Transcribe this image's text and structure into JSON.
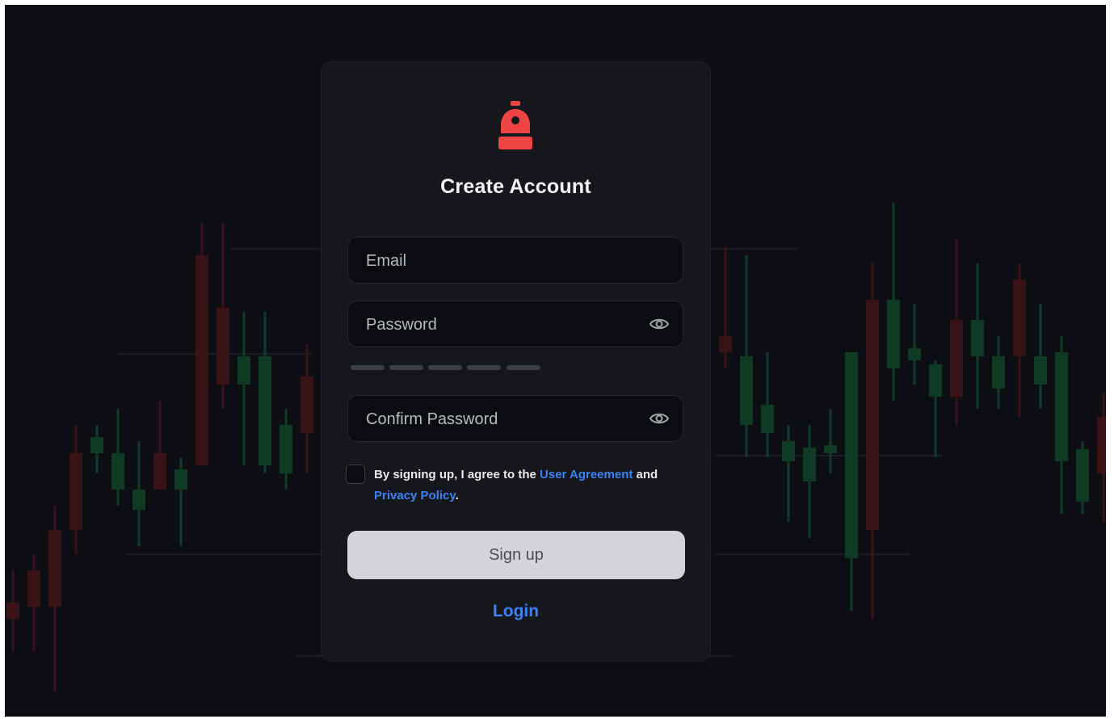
{
  "brand": {
    "accent_color": "#ef4444",
    "logo_icon": "padlock-icon"
  },
  "form": {
    "title": "Create Account",
    "email_placeholder": "Email",
    "password_placeholder": "Password",
    "confirm_placeholder": "Confirm Password",
    "show_password_icon": "eye-icon",
    "strength_meter": {
      "segments": 5,
      "filled": 0
    },
    "agreement": {
      "checked": false,
      "text_before": "By signing up, I agree to the ",
      "user_agreement_link": "User Agreement",
      "text_middle": " and",
      "privacy_policy_link": "Privacy Policy",
      "text_after": "."
    },
    "signup_label": "Sign up",
    "login_label": "Login",
    "link_color": "#3b82f6",
    "button_color": "#d4d4d8"
  },
  "background": {
    "description_colors": {
      "up": "#16a34a",
      "down": "#dc2626"
    }
  }
}
